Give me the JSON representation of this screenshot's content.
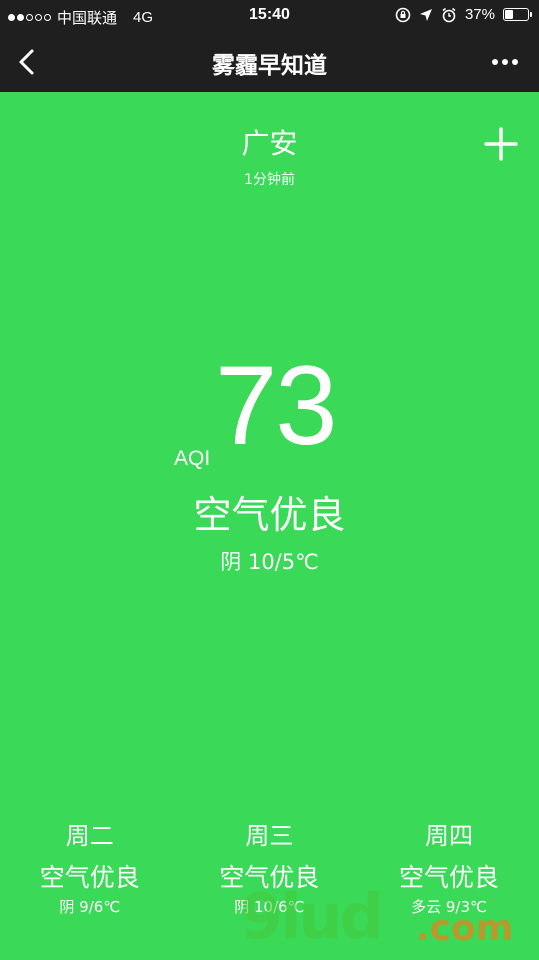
{
  "status_bar": {
    "carrier": "中国联通",
    "network": "4G",
    "time": "15:40",
    "battery_percent": "37%",
    "battery_level": 0.37,
    "signal_strength": 2,
    "signal_total": 5,
    "icons": [
      "rotation-lock-icon",
      "location-arrow-icon",
      "alarm-icon",
      "battery-icon"
    ]
  },
  "nav": {
    "title": "雾霾早知道",
    "back_icon": "chevron-left-icon",
    "more_icon": "more-dots-icon"
  },
  "city": {
    "name": "广安",
    "updated": "1分钟前",
    "add_icon": "plus-icon"
  },
  "aqi": {
    "label": "AQI",
    "value": "73",
    "status": "空气优良",
    "weather": "阴 10/5℃"
  },
  "forecast": [
    {
      "day": "周二",
      "status": "空气优良",
      "weather": "阴 9/6℃"
    },
    {
      "day": "周三",
      "status": "空气优良",
      "weather": "阴 10/6℃"
    },
    {
      "day": "周四",
      "status": "空气优良",
      "weather": "多云 9/3℃"
    }
  ],
  "watermark": {
    "main": "9lud",
    "suffix": ".com"
  },
  "colors": {
    "background": "#3ad957",
    "bar": "#1f1f1f",
    "text": "#ffffff"
  }
}
